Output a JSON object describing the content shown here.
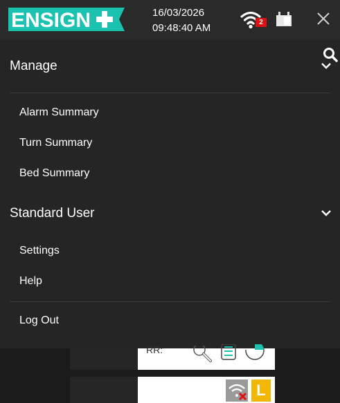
{
  "header": {
    "logo_text": "ENSIGN",
    "date": "16/03/2026",
    "time": "09:48:40 AM",
    "wifi_icon": "wifi-icon",
    "wifi_badge": "2",
    "battery_icon": "battery-icon",
    "close_icon": "close-icon",
    "colors": {
      "brand": "#1cc2b0",
      "badge": "#e01010"
    }
  },
  "menu": {
    "search_icon": "search-icon",
    "manage": {
      "label": "Manage",
      "items": [
        "Alarm Summary",
        "Turn Summary",
        "Bed Summary"
      ]
    },
    "user": {
      "label": "Standard User",
      "items": [
        "Settings",
        "Help"
      ]
    },
    "logout_label": "Log Out"
  },
  "background": {
    "card1_text": "RR:",
    "card2_badge": "L"
  }
}
